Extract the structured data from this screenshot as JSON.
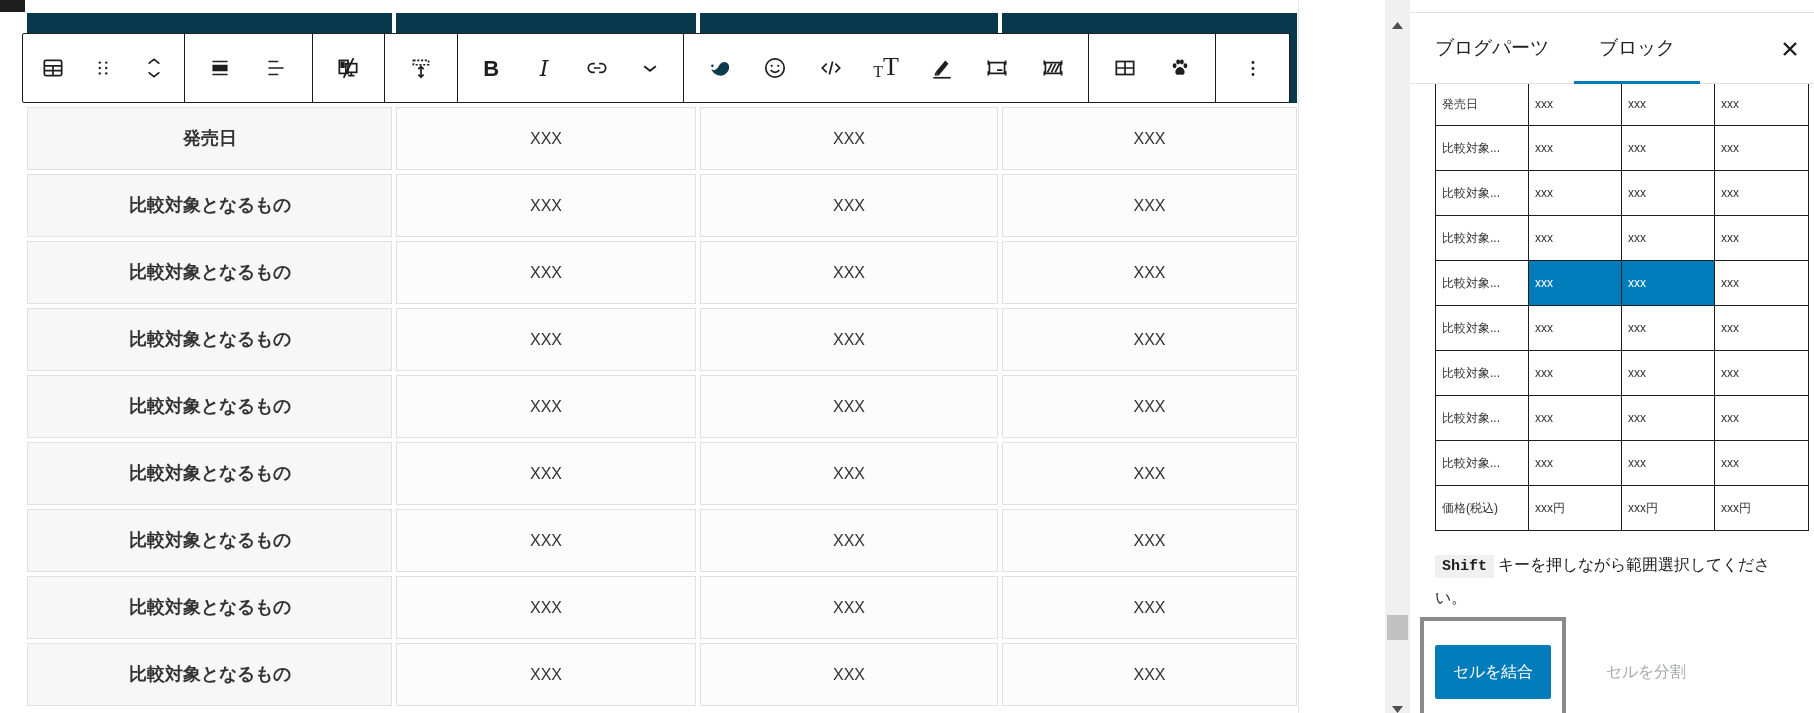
{
  "editor_table": {
    "rows": [
      {
        "label": "発売日",
        "values": [
          "XXX",
          "XXX",
          "XXX"
        ]
      },
      {
        "label": "比較対象となるもの",
        "values": [
          "XXX",
          "XXX",
          "XXX"
        ]
      },
      {
        "label": "比較対象となるもの",
        "values": [
          "XXX",
          "XXX",
          "XXX"
        ]
      },
      {
        "label": "比較対象となるもの",
        "values": [
          "XXX",
          "XXX",
          "XXX"
        ]
      },
      {
        "label": "比較対象となるもの",
        "values": [
          "XXX",
          "XXX",
          "XXX"
        ]
      },
      {
        "label": "比較対象となるもの",
        "values": [
          "XXX",
          "XXX",
          "XXX"
        ]
      },
      {
        "label": "比較対象となるもの",
        "values": [
          "XXX",
          "XXX",
          "XXX"
        ]
      },
      {
        "label": "比較対象となるもの",
        "values": [
          "XXX",
          "XXX",
          "XXX"
        ]
      },
      {
        "label": "比較対象となるもの",
        "values": [
          "XXX",
          "XXX",
          "XXX"
        ]
      }
    ]
  },
  "toolbar": {
    "bold": "B",
    "italic": "I",
    "text_size": "TT"
  },
  "sidebar": {
    "tabs": [
      {
        "label": "ブログパーツ",
        "selected": false
      },
      {
        "label": "ブロック",
        "selected": true
      }
    ],
    "preview_table": {
      "rows": [
        {
          "cells": [
            {
              "text": "発売日",
              "selected": false
            },
            {
              "text": "xxx",
              "selected": false
            },
            {
              "text": "xxx",
              "selected": false
            },
            {
              "text": "xxx",
              "selected": false
            }
          ]
        },
        {
          "cells": [
            {
              "text": "比較対象...",
              "selected": false
            },
            {
              "text": "xxx",
              "selected": false
            },
            {
              "text": "xxx",
              "selected": false
            },
            {
              "text": "xxx",
              "selected": false
            }
          ]
        },
        {
          "cells": [
            {
              "text": "比較対象...",
              "selected": false
            },
            {
              "text": "xxx",
              "selected": false
            },
            {
              "text": "xxx",
              "selected": false
            },
            {
              "text": "xxx",
              "selected": false
            }
          ]
        },
        {
          "cells": [
            {
              "text": "比較対象...",
              "selected": false
            },
            {
              "text": "xxx",
              "selected": false
            },
            {
              "text": "xxx",
              "selected": false
            },
            {
              "text": "xxx",
              "selected": false
            }
          ]
        },
        {
          "cells": [
            {
              "text": "比較対象...",
              "selected": false
            },
            {
              "text": "xxx",
              "selected": true
            },
            {
              "text": "xxx",
              "selected": true
            },
            {
              "text": "xxx",
              "selected": false
            }
          ]
        },
        {
          "cells": [
            {
              "text": "比較対象...",
              "selected": false
            },
            {
              "text": "xxx",
              "selected": false
            },
            {
              "text": "xxx",
              "selected": false
            },
            {
              "text": "xxx",
              "selected": false
            }
          ]
        },
        {
          "cells": [
            {
              "text": "比較対象...",
              "selected": false
            },
            {
              "text": "xxx",
              "selected": false
            },
            {
              "text": "xxx",
              "selected": false
            },
            {
              "text": "xxx",
              "selected": false
            }
          ]
        },
        {
          "cells": [
            {
              "text": "比較対象...",
              "selected": false
            },
            {
              "text": "xxx",
              "selected": false
            },
            {
              "text": "xxx",
              "selected": false
            },
            {
              "text": "xxx",
              "selected": false
            }
          ]
        },
        {
          "cells": [
            {
              "text": "比較対象...",
              "selected": false
            },
            {
              "text": "xxx",
              "selected": false
            },
            {
              "text": "xxx",
              "selected": false
            },
            {
              "text": "xxx",
              "selected": false
            }
          ]
        },
        {
          "cells": [
            {
              "text": "価格(税込)",
              "selected": false
            },
            {
              "text": "xxx円",
              "selected": false
            },
            {
              "text": "xxx円",
              "selected": false
            },
            {
              "text": "xxx円",
              "selected": false
            }
          ]
        }
      ]
    },
    "hint": {
      "key": "Shift",
      "text": "キーを押しながら範囲選択してください。"
    },
    "buttons": [
      {
        "label": "セルを結合",
        "disabled": false
      },
      {
        "label": "セルを分割",
        "disabled": true
      }
    ]
  }
}
